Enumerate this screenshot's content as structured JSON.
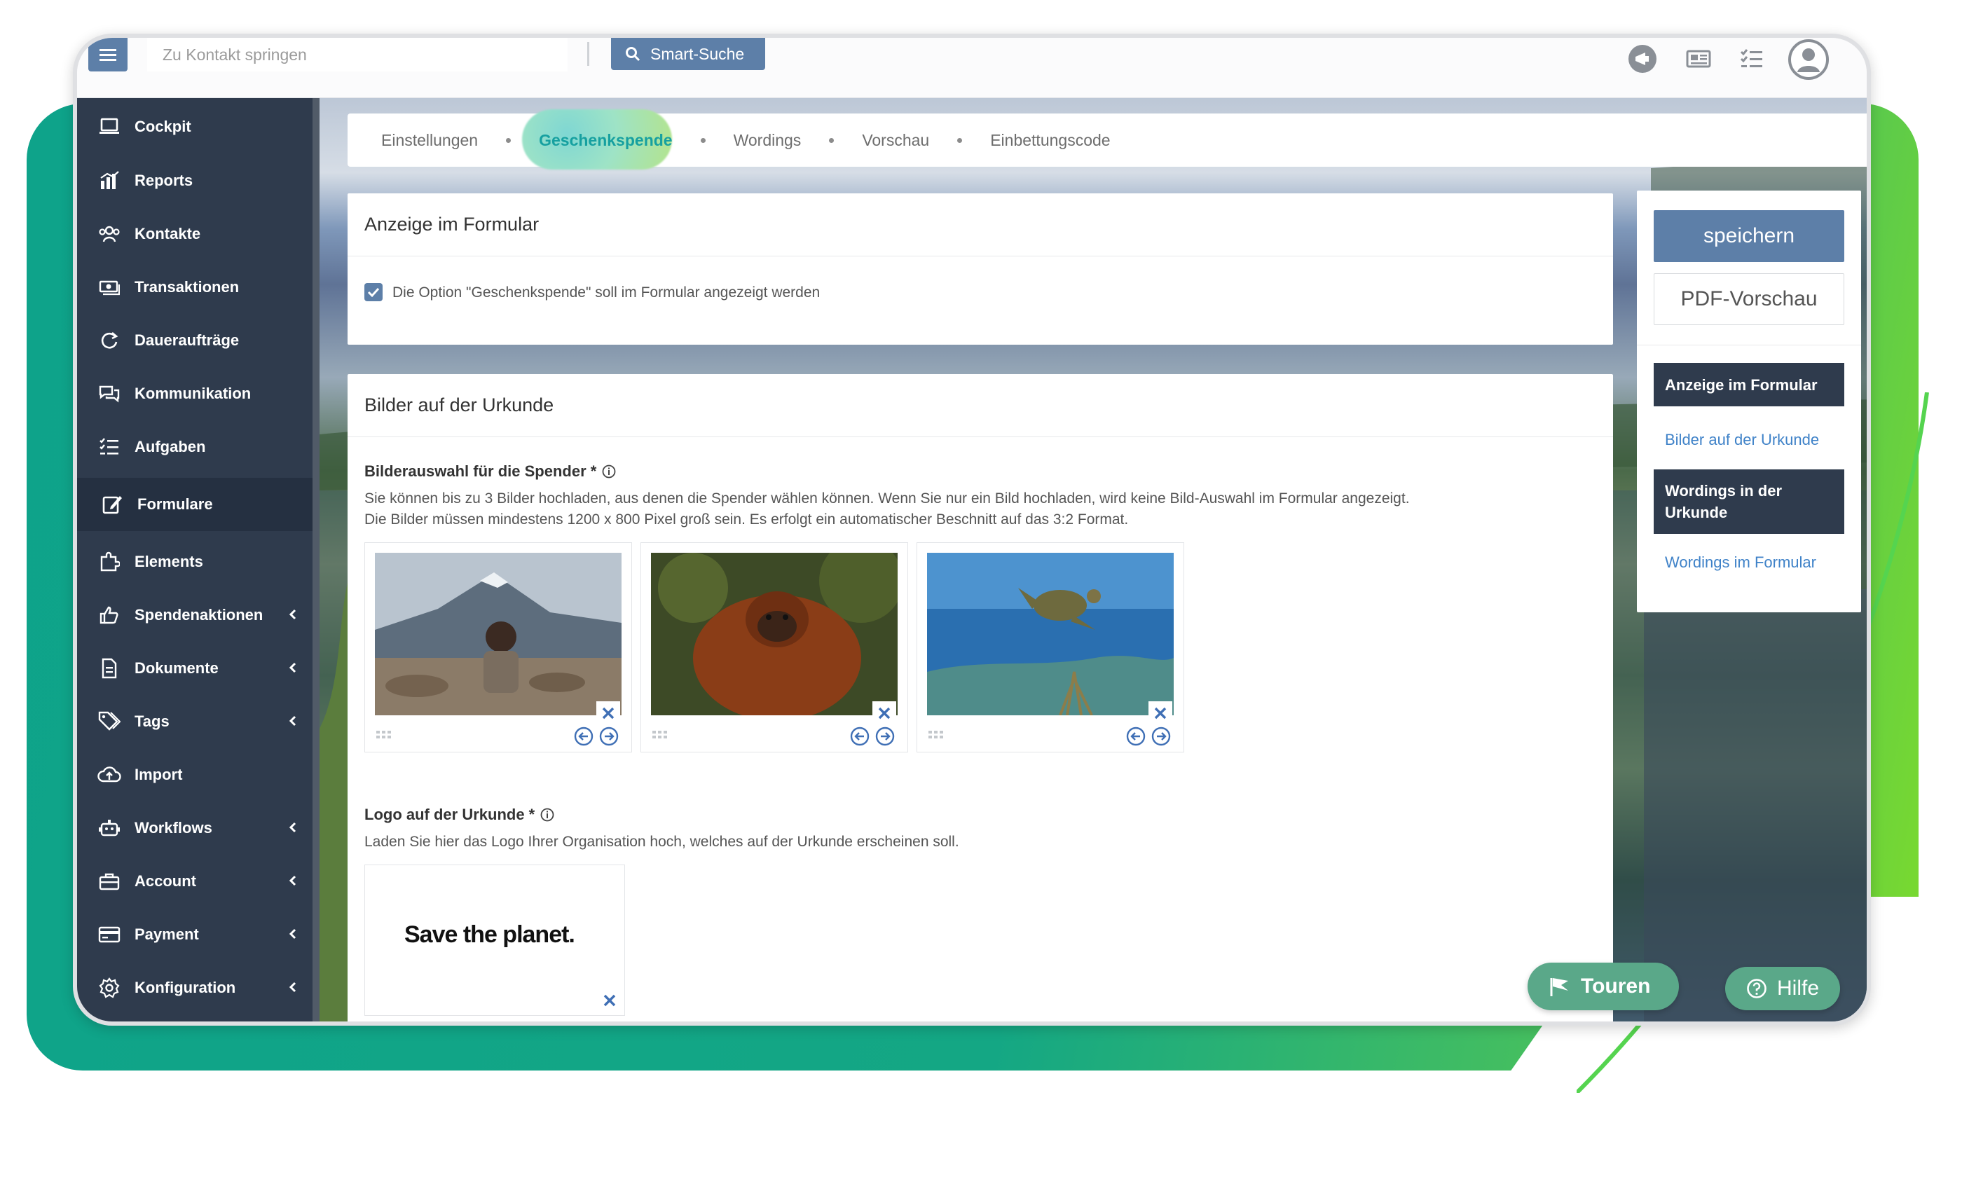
{
  "topbar": {
    "jump_placeholder": "Zu Kontakt springen",
    "smart_search_label": "Smart-Suche"
  },
  "sidebar": {
    "items": [
      {
        "label": "Cockpit",
        "icon": "laptop-icon"
      },
      {
        "label": "Reports",
        "icon": "bar-chart-icon"
      },
      {
        "label": "Kontakte",
        "icon": "users-icon"
      },
      {
        "label": "Transaktionen",
        "icon": "money-icon"
      },
      {
        "label": "Daueraufträge",
        "icon": "refresh-icon"
      },
      {
        "label": "Kommunikation",
        "icon": "chat-icon"
      },
      {
        "label": "Aufgaben",
        "icon": "checklist-icon"
      },
      {
        "label": "Formulare",
        "icon": "edit-icon"
      },
      {
        "label": "Elements",
        "icon": "puzzle-icon"
      },
      {
        "label": "Spendenaktionen",
        "icon": "thumbs-up-icon"
      },
      {
        "label": "Dokumente",
        "icon": "document-icon"
      },
      {
        "label": "Tags",
        "icon": "tags-icon"
      },
      {
        "label": "Import",
        "icon": "cloud-upload-icon"
      },
      {
        "label": "Workflows",
        "icon": "robot-icon"
      },
      {
        "label": "Account",
        "icon": "briefcase-icon"
      },
      {
        "label": "Payment",
        "icon": "credit-card-icon"
      },
      {
        "label": "Konfiguration",
        "icon": "gear-icon"
      }
    ]
  },
  "tabs": {
    "items": [
      "Einstellungen",
      "Geschenkspende",
      "Wordings",
      "Vorschau",
      "Einbettungscode"
    ],
    "active": "Geschenkspende"
  },
  "anzeige": {
    "title": "Anzeige im Formular",
    "checkbox_label": "Die Option \"Geschenkspende\" soll im Formular angezeigt werden",
    "checked": true
  },
  "bilder": {
    "title": "Bilder auf der Urkunde",
    "selection_label": "Bilderauswahl für die Spender *",
    "help_line1": "Sie können bis zu 3 Bilder hochladen, aus denen die Spender wählen können. Wenn Sie nur ein Bild hochladen, wird keine Bild-Auswahl im Formular angezeigt.",
    "help_line2": "Die Bilder müssen mindestens 1200 x 800 Pixel groß sein. Es erfolgt ein automatischer Beschnitt auf das 3:2 Format.",
    "logo_label": "Logo auf der Urkunde *",
    "logo_help": "Laden Sie hier das Logo Ihrer Organisation hoch, welches auf der Urkunde erscheinen soll.",
    "logo_text": "Save the planet."
  },
  "panel": {
    "save_label": "speichern",
    "pdf_label": "PDF-Vorschau",
    "nav": [
      {
        "label": "Anzeige im Formular",
        "style": "dark"
      },
      {
        "label": "Bilder auf der Urkunde",
        "style": "link"
      },
      {
        "label": "Wordings in der Urkunde",
        "style": "dark"
      },
      {
        "label": "Wordings im Formular",
        "style": "link"
      }
    ]
  },
  "floating": {
    "touren_label": "Touren",
    "hilfe_label": "Hilfe"
  },
  "colors": {
    "primary": "#5d7fa8",
    "sidebar": "#2f3b4d",
    "accent_green": "#14a784",
    "tab_active": "#16a0a0",
    "link": "#3f82c8"
  }
}
